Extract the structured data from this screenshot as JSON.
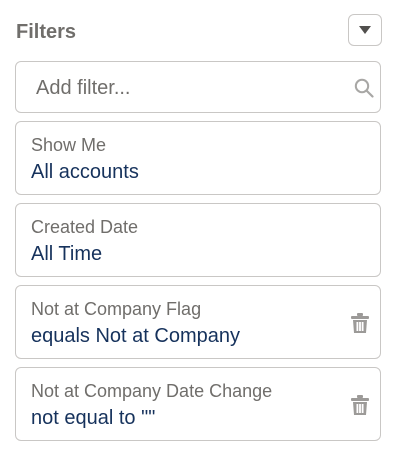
{
  "header": {
    "title": "Filters"
  },
  "icons": {
    "dropdown": "chevron-down-icon",
    "search": "search-icon",
    "delete": "trash-icon"
  },
  "search": {
    "placeholder": "Add filter..."
  },
  "filters": [
    {
      "label": "Show Me",
      "value": "All accounts",
      "removable": false
    },
    {
      "label": "Created Date",
      "value": "All Time",
      "removable": false
    },
    {
      "label": "Not at Company Flag",
      "value": "equals Not at Company",
      "removable": true
    },
    {
      "label": "Not at Company Date Change",
      "value": "not equal to \"\"",
      "removable": true
    }
  ],
  "colors": {
    "title": "#706e6b",
    "label": "#706e6b",
    "value": "#16325c",
    "border": "#c9c7c5",
    "icon": "#706e6b"
  }
}
